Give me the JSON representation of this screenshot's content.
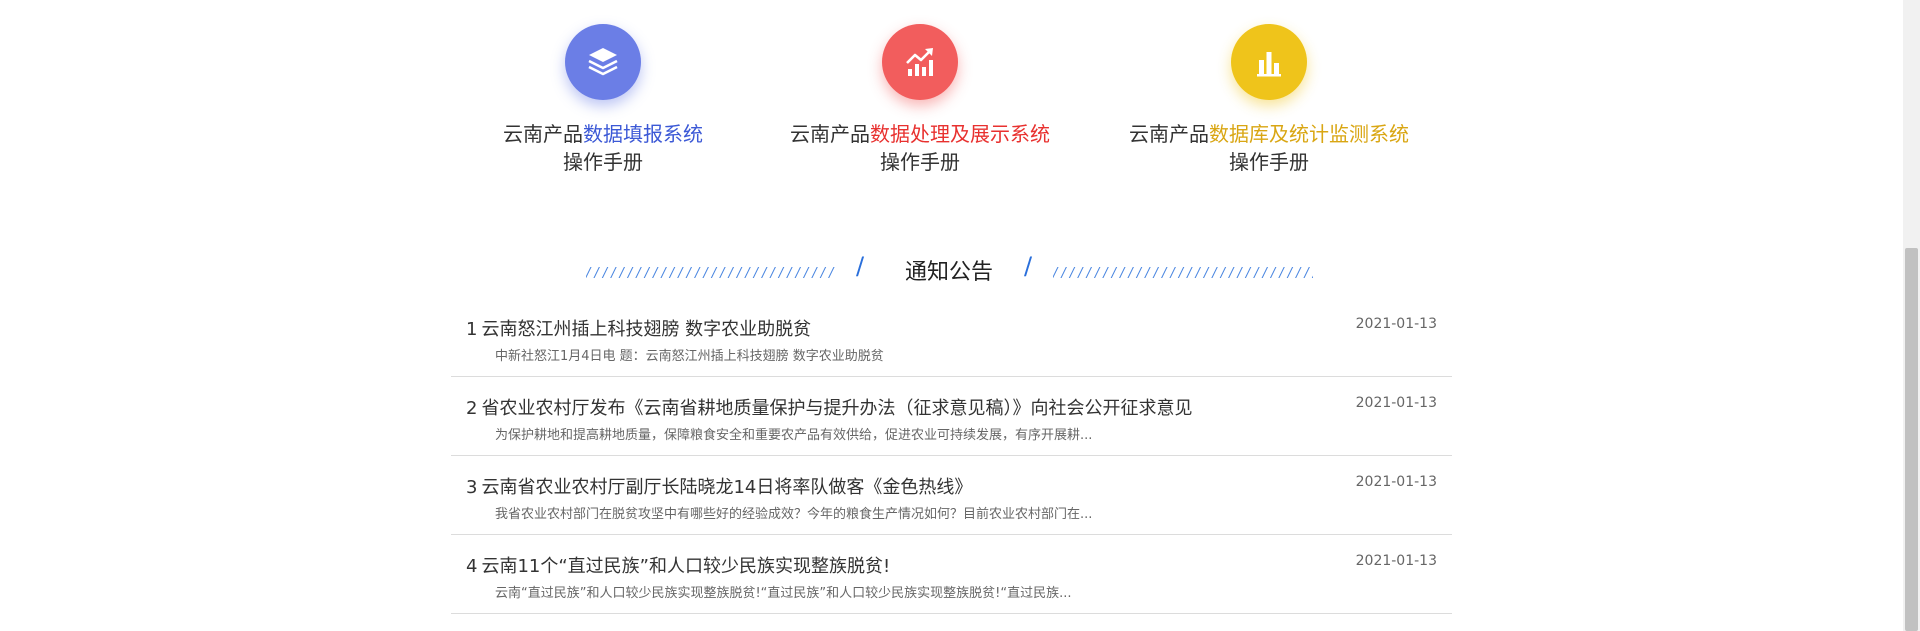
{
  "manuals": [
    {
      "icon": "layers-icon",
      "prefix": "云南产品",
      "highlight": "数据填报系统",
      "subtitle": "操作手册",
      "color": "#6b7ee6"
    },
    {
      "icon": "trend-chart-icon",
      "prefix": "云南产品",
      "highlight": "数据处理及展示系统",
      "subtitle": "操作手册",
      "color": "#f25d5d"
    },
    {
      "icon": "bar-chart-icon",
      "prefix": "云南产品",
      "highlight": "数据库及统计监测系统",
      "subtitle": "操作手册",
      "color": "#efc41b"
    }
  ],
  "notices": {
    "title": "通知公告",
    "items": [
      {
        "num": "1",
        "title": "云南怒江州插上科技翅膀 数字农业助脱贫",
        "summary": "中新社怒江1月4日电 题：云南怒江州插上科技翅膀 数字农业助脱贫",
        "date": "2021-01-13"
      },
      {
        "num": "2",
        "title": "省农业农村厅发布《云南省耕地质量保护与提升办法（征求意见稿）》向社会公开征求意见",
        "summary": "为保护耕地和提高耕地质量，保障粮食安全和重要农产品有效供给，促进农业可持续发展，有序开展耕...",
        "date": "2021-01-13"
      },
      {
        "num": "3",
        "title": "云南省农业农村厅副厅长陆晓龙14日将率队做客《金色热线》",
        "summary": "我省农业农村部门在脱贫攻坚中有哪些好的经验成效？今年的粮食生产情况如何？目前农业农村部门在...",
        "date": "2021-01-13"
      },
      {
        "num": "4",
        "title": "云南11个“直过民族”和人口较少民族实现整族脱贫!",
        "summary": "云南“直过民族”和人口较少民族实现整族脱贫!“直过民族”和人口较少民族实现整族脱贫!“直过民族...",
        "date": "2021-01-13"
      }
    ]
  }
}
